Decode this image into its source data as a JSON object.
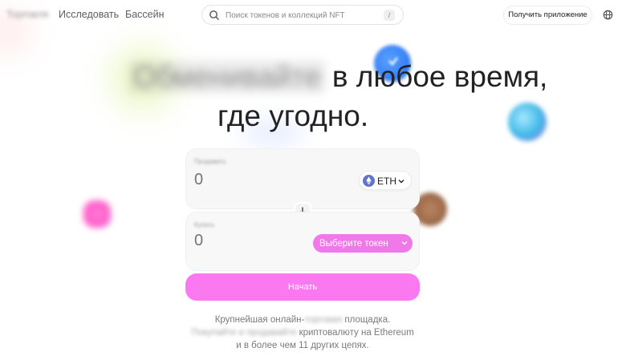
{
  "nav": {
    "links": [
      "Торговля",
      "Исследовать",
      "Бассейн"
    ],
    "search_placeholder": "Поиск токенов и коллекций NFT",
    "search_shortcut": "/",
    "get_app_label": "Получить приложение",
    "icons": [
      "search-icon",
      "globe-icon"
    ]
  },
  "hero": {
    "line1_blurred": "Обменивайте",
    "line1_rest": "в любое время,",
    "line2": "где угодно."
  },
  "swap": {
    "sell": {
      "label": "Продавать",
      "amount_placeholder": "0",
      "token": "ETH"
    },
    "buy": {
      "label": "Купить",
      "amount_placeholder": "0",
      "select_token_label": "Выберите токен"
    },
    "start_label": "Начать"
  },
  "tagline": {
    "l1_a": "Крупнейшая онлайн-",
    "l1_blur": "торговая",
    "l1_b": " площадка.",
    "l2_blur": "Покупайте и продавайте",
    "l2_b": " криптовалюту на Ethereum",
    "l3": "и в более чем 11 других цепях."
  },
  "colors": {
    "accent_pink": "#fb79f0",
    "select_pink": "#f178e8",
    "eth_blue": "#6274c8"
  }
}
